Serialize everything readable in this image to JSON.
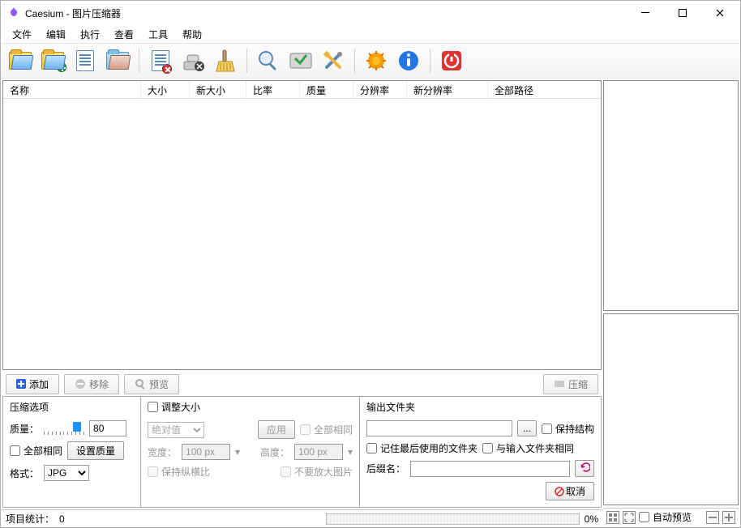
{
  "window": {
    "title": "Caesium - 图片压缩器"
  },
  "menu": {
    "file": "文件",
    "edit": "编辑",
    "action": "执行",
    "view": "查看",
    "tools": "工具",
    "help": "帮助"
  },
  "columns": {
    "name": "名称",
    "size": "大小",
    "new_size": "新大小",
    "ratio": "比率",
    "quality": "质量",
    "resolution": "分辨率",
    "new_resolution": "新分辨率",
    "full_path": "全部路径"
  },
  "actions": {
    "add": "添加",
    "remove": "移除",
    "preview": "预览",
    "compress": "压缩"
  },
  "compress_panel": {
    "header": "压缩选项",
    "quality_label": "质量：",
    "quality_value": "80",
    "same_all": "全部相同",
    "set_quality_btn": "设置质量",
    "format_label": "格式：",
    "format_value": "JPG"
  },
  "resize_panel": {
    "header": "调整大小",
    "mode": "绝对值",
    "apply": "应用",
    "same_all": "全部相同",
    "width_label": "宽度：",
    "width_value": "100 px",
    "height_label": "高度：",
    "height_value": "100 px",
    "keep_ratio": "保持纵横比",
    "no_enlarge": "不要放大图片"
  },
  "output_panel": {
    "header": "输出文件夹",
    "browse": "...",
    "keep_structure": "保持结构",
    "remember_last": "记住最后使用的文件夹",
    "same_as_input": "与输入文件夹相同",
    "suffix_label": "后缀名：",
    "cancel": "取消"
  },
  "status": {
    "items_label": "项目统计：",
    "items_count": "0",
    "progress_pct": "0%",
    "auto_preview": "自动预览"
  }
}
